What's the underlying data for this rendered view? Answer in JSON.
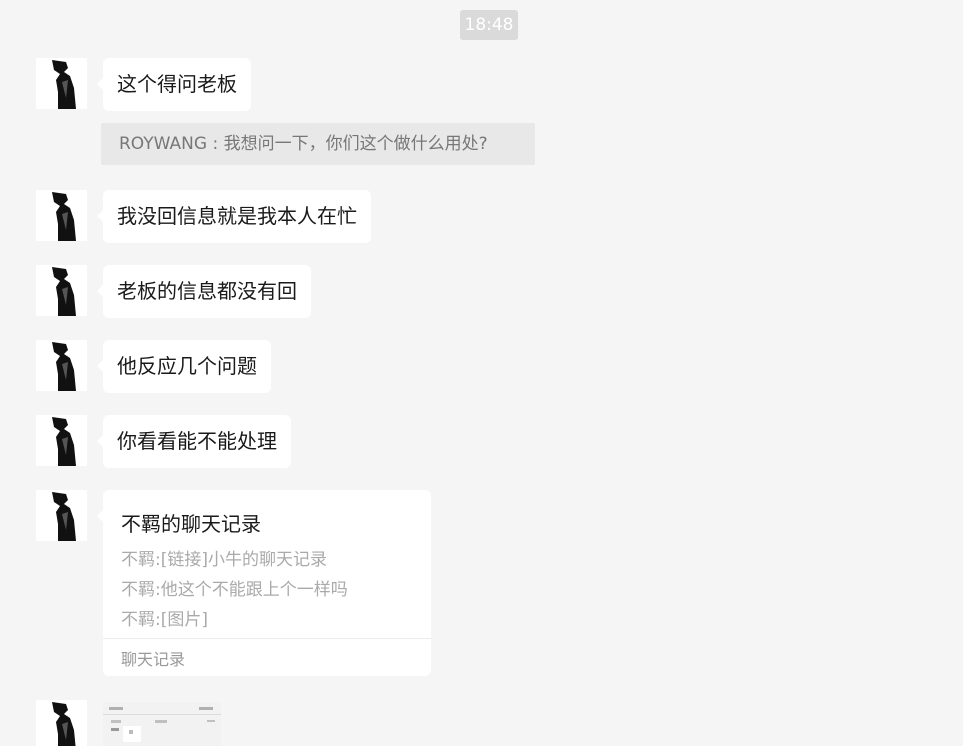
{
  "timestamp": "18:48",
  "messages": [
    {
      "text": "这个得问老板"
    },
    {
      "text": "我没回信息就是我本人在忙"
    },
    {
      "text": "老板的信息都没有回"
    },
    {
      "text": "他反应几个问题"
    },
    {
      "text": "你看看能不能处理"
    }
  ],
  "quote": {
    "text": "ROYWANG : 我想问一下，你们这个做什么用处?"
  },
  "chat_record_card": {
    "title": "不羁的聊天记录",
    "lines": [
      "不羁:[链接]小牛的聊天记录",
      "不羁:他这个不能跟上个一样吗",
      "不羁:[图片]"
    ],
    "footer": "聊天记录"
  },
  "icons": {
    "avatar": "user-avatar-photo",
    "image": "screenshot-image-thumbnail"
  }
}
